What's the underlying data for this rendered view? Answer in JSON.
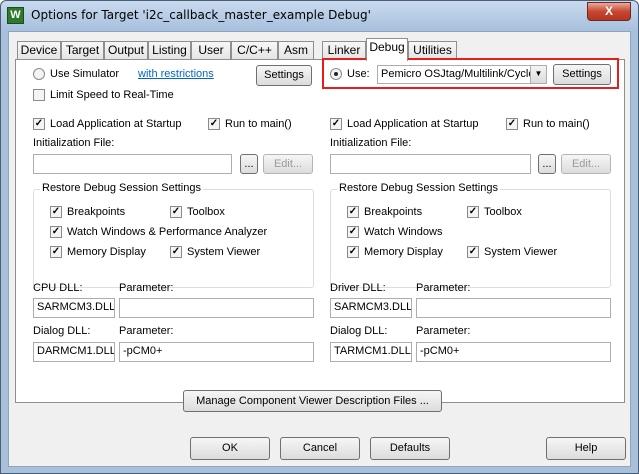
{
  "window": {
    "title": "Options for Target 'i2c_callback_master_example Debug'",
    "app_icon": "W",
    "close": "X"
  },
  "tabs": [
    {
      "label": "Device"
    },
    {
      "label": "Target"
    },
    {
      "label": "Output"
    },
    {
      "label": "Listing"
    },
    {
      "label": "User"
    },
    {
      "label": "C/C++"
    },
    {
      "label": "Asm"
    },
    {
      "label": "Linker"
    },
    {
      "label": "Debug"
    },
    {
      "label": "Utilities"
    }
  ],
  "left": {
    "use_simulator": "Use Simulator",
    "with_restrictions": "with restrictions",
    "settings": "Settings",
    "limit_speed": "Limit Speed to Real-Time",
    "load_app": "Load Application at Startup",
    "run_to_main": "Run to main()",
    "init_file": "Initialization File:",
    "browse": "...",
    "edit": "Edit...",
    "restore_title": "Restore Debug Session Settings",
    "breakpoints": "Breakpoints",
    "toolbox": "Toolbox",
    "watch": "Watch Windows & Performance Analyzer",
    "memory": "Memory Display",
    "sysviewer": "System Viewer",
    "dll_label": "CPU DLL:",
    "param_label": "Parameter:",
    "dll_value": "SARMCM3.DLL",
    "param_value": "",
    "dialog_dll_label": "Dialog DLL:",
    "dialog_param_label": "Parameter:",
    "dialog_dll_value": "DARMCM1.DLL",
    "dialog_param_value": "-pCM0+"
  },
  "right": {
    "use": "Use:",
    "driver_selected": "Pemicro OSJtag/Multilink/Cyclo",
    "settings": "Settings",
    "load_app": "Load Application at Startup",
    "run_to_main": "Run to main()",
    "init_file": "Initialization File:",
    "browse": "...",
    "edit": "Edit...",
    "restore_title": "Restore Debug Session Settings",
    "breakpoints": "Breakpoints",
    "toolbox": "Toolbox",
    "watch": "Watch Windows",
    "memory": "Memory Display",
    "sysviewer": "System Viewer",
    "dll_label": "Driver DLL:",
    "param_label": "Parameter:",
    "dll_value": "SARMCM3.DLL",
    "param_value": "",
    "dialog_dll_label": "Dialog DLL:",
    "dialog_param_label": "Parameter:",
    "dialog_dll_value": "TARMCM1.DLL",
    "dialog_param_value": "-pCM0+"
  },
  "manage_button": "Manage Component Viewer Description Files ...",
  "buttons": {
    "ok": "OK",
    "cancel": "Cancel",
    "defaults": "Defaults",
    "help": "Help"
  },
  "checkmark": "✓",
  "colors": {
    "highlight": "#e41d1d",
    "link": "#0066cc",
    "title_bar": "#a7c0dd"
  }
}
